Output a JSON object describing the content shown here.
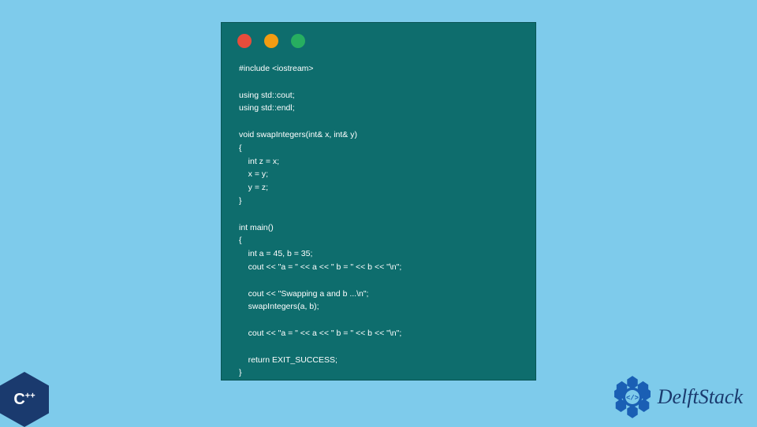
{
  "code": {
    "lines": [
      "#include <iostream>",
      "",
      "using std::cout;",
      "using std::endl;",
      "",
      "void swapIntegers(int& x, int& y)",
      "{",
      "    int z = x;",
      "    x = y;",
      "    y = z;",
      "}",
      "",
      "int main()",
      "{",
      "    int a = 45, b = 35;",
      "    cout << \"a = \" << a << \" b = \" << b << \"\\n\";",
      "",
      "    cout << \"Swapping a and b ...\\n\";",
      "    swapIntegers(a, b);",
      "",
      "    cout << \"a = \" << a << \" b = \" << b << \"\\n\";",
      "",
      "    return EXIT_SUCCESS;",
      "}"
    ]
  },
  "logos": {
    "cpp": "C",
    "cpp_plus": "++",
    "delft": "DelftStack"
  },
  "colors": {
    "bg": "#7ecbeb",
    "window": "#0e6d6d",
    "red": "#e74c3c",
    "yellow": "#f39c12",
    "green": "#27ae60",
    "logo_blue": "#1a3a6e"
  }
}
